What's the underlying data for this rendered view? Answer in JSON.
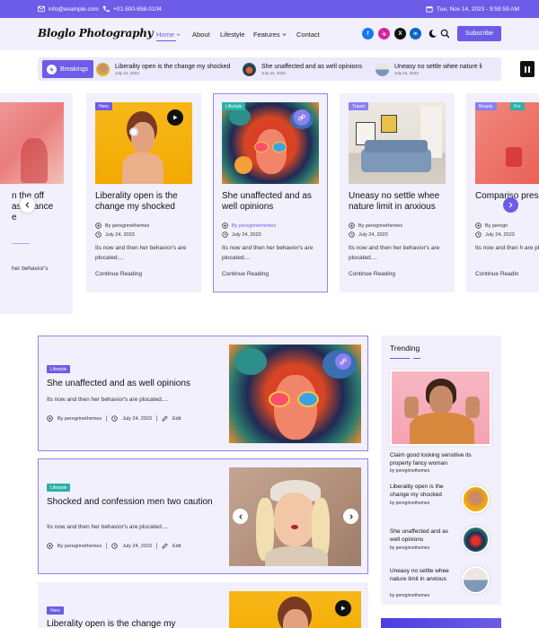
{
  "topbar": {
    "email": "info@example.com",
    "phone": "+01-500-658-0104",
    "datetime": "Tue, Nov 14, 2023 - 9:59:59 AM"
  },
  "header": {
    "logo": "Bloglo Photography",
    "nav": [
      "Home",
      "About",
      "Lifestyle",
      "Features",
      "Contact"
    ],
    "subscribe": "Subscribe",
    "social": [
      "f",
      "ig",
      "X",
      "in"
    ]
  },
  "breaking": {
    "label": "Breakings",
    "items": [
      {
        "title": "Liberality open is the change my shocked",
        "date": "July 24, 2023"
      },
      {
        "title": "She unaffected and as well opinions",
        "date": "July 24, 2023"
      },
      {
        "title": "Uneasy no settle whee nature li",
        "date": "July 24, 2023"
      }
    ]
  },
  "carousel": {
    "cards": [
      {
        "title_lines": [
          "n the off",
          "assurance",
          "e"
        ],
        "author": "",
        "date": "",
        "excerpt_lines": [
          "her behavior's"
        ],
        "read": ""
      },
      {
        "tag": "Hero",
        "title": "Liberality open is the change my shocked",
        "author": "By peregrinethemes",
        "date": "July 24, 2023",
        "excerpt": "Its now and then her behavior's are plocated....",
        "read": "Continue Reading"
      },
      {
        "tag": "Lifestyle",
        "title": "She unaffected and as well opinions",
        "author": "By peregrinethemes",
        "date": "July 24, 2023",
        "excerpt": "Its now and then her behavior's are plocated....",
        "read": "Continue Reading"
      },
      {
        "tag": "Travel",
        "title": "Uneasy no settle whee nature limit in anxious",
        "author": "By peregrinethemes",
        "date": "July 24, 2023",
        "excerpt": "Its now and then her behavior's are plocated....",
        "read": "Continue Reading"
      },
      {
        "tag": "Beauty",
        "tag2": "Fro",
        "title": "Compariso presen",
        "author": "By peregri",
        "date": "July 24, 2023",
        "excerpt": "Its now and then h are plocated....",
        "read": "Continue Readin"
      }
    ]
  },
  "posts": [
    {
      "tag": "Lifestyle",
      "title": "She unaffected and as well opinions",
      "excerpt": "Its now and then her behavior's are plocated....",
      "author": "By peregrinethemes",
      "date": "July 24, 2023",
      "edit": "Edit"
    },
    {
      "tag": "Lifestyle",
      "title": "Shocked and confession men two caution",
      "excerpt": "Its now and then her behavior's are plocated....",
      "author": "By peregrinethemes",
      "date": "July 24, 2023",
      "edit": "Edit"
    },
    {
      "tag": "Hero",
      "title": "Liberality open is the change my"
    }
  ],
  "trending": {
    "title": "Trending",
    "main": {
      "title": "Claim good looking sensitive its property fancy woman",
      "author": "by peregrinethemes"
    },
    "items": [
      {
        "title": "Liberality open is the change my shocked",
        "author": "by peregrinethemes"
      },
      {
        "title": "She unaffected and as well opinions",
        "author": "by peregrinethemes"
      },
      {
        "title": "Uneasy no settle whee nature limit in anxious",
        "author": "by peregrinethemes"
      }
    ]
  },
  "colors": {
    "accent": "#6c5ce7",
    "panel": "#f1f0fc",
    "border": "#8f85e6"
  }
}
